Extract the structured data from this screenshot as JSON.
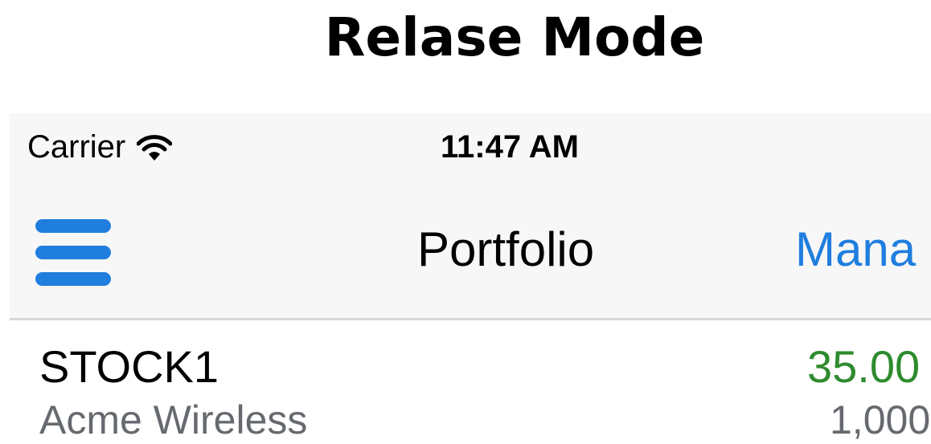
{
  "caption": "Relase Mode",
  "status_bar": {
    "carrier": "Carrier",
    "time": "11:47 AM",
    "wifi_icon": "wifi-icon"
  },
  "nav_bar": {
    "menu_icon": "hamburger-menu-icon",
    "title": "Portfolio",
    "right_button": "Mana"
  },
  "rows": [
    {
      "symbol": "STOCK1",
      "company": "Acme Wireless",
      "price": "35.00",
      "shares": "1,000"
    }
  ],
  "colors": {
    "accent": "#1f7ede",
    "price_up": "#2e8b2e",
    "secondary_text": "#666a6f",
    "bar_background": "#f7f7f7"
  }
}
